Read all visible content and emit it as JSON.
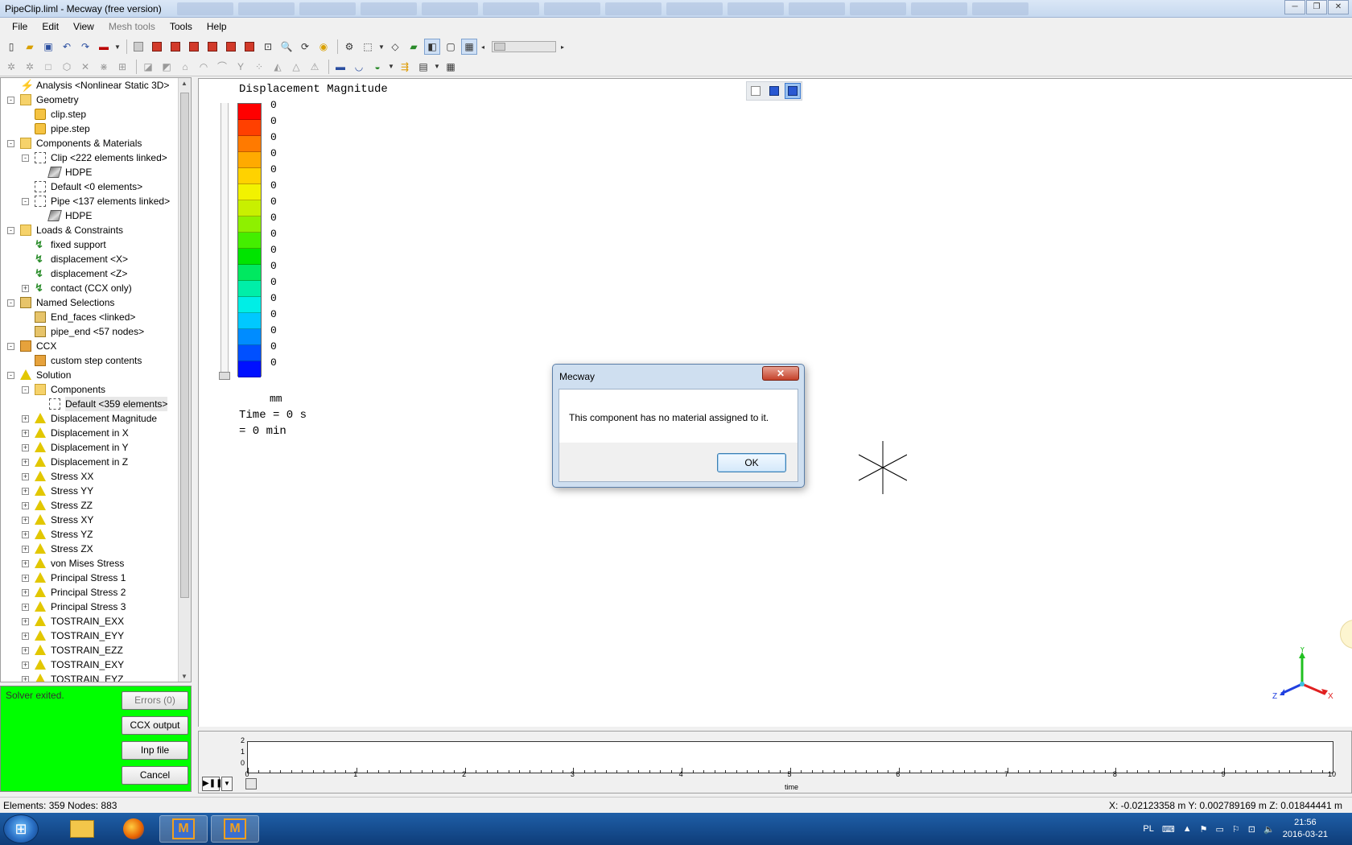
{
  "window": {
    "title": "PipeClip.liml - Mecway (free version)",
    "controls": [
      "─",
      "❐",
      "✕"
    ]
  },
  "menu": [
    "File",
    "Edit",
    "View",
    "Mesh tools",
    "Tools",
    "Help"
  ],
  "tree": {
    "items": [
      {
        "label": "Analysis <Nonlinear Static 3D>",
        "icon": "analysis-icon",
        "level": 1,
        "expander": ""
      },
      {
        "label": "Geometry",
        "icon": "folder-icon",
        "level": 1,
        "expander": "-"
      },
      {
        "label": "clip.step",
        "icon": "step-file-icon",
        "level": 2,
        "expander": ""
      },
      {
        "label": "pipe.step",
        "icon": "step-file-icon",
        "level": 2,
        "expander": ""
      },
      {
        "label": "Components & Materials",
        "icon": "components-folder-icon",
        "level": 1,
        "expander": "-"
      },
      {
        "label": "Clip <222 elements linked>",
        "icon": "component-icon",
        "level": 2,
        "expander": "-"
      },
      {
        "label": "HDPE",
        "icon": "material-icon",
        "level": 3,
        "expander": ""
      },
      {
        "label": "Default <0 elements>",
        "icon": "component-icon",
        "level": 2,
        "expander": ""
      },
      {
        "label": "Pipe <137 elements linked>",
        "icon": "component-icon",
        "level": 2,
        "expander": "-"
      },
      {
        "label": "HDPE",
        "icon": "material-icon",
        "level": 3,
        "expander": ""
      },
      {
        "label": "Loads & Constraints",
        "icon": "loads-folder-icon",
        "level": 1,
        "expander": "-"
      },
      {
        "label": "fixed support",
        "icon": "load-icon",
        "level": 2,
        "expander": ""
      },
      {
        "label": "displacement <X>",
        "icon": "load-icon",
        "level": 2,
        "expander": ""
      },
      {
        "label": "displacement <Z>",
        "icon": "load-icon",
        "level": 2,
        "expander": ""
      },
      {
        "label": "contact (CCX only)",
        "icon": "contact-icon",
        "level": 2,
        "expander": "+"
      },
      {
        "label": "Named Selections",
        "icon": "named-selection-folder-icon",
        "level": 1,
        "expander": "-"
      },
      {
        "label": "End_faces <linked>",
        "icon": "named-selection-icon",
        "level": 2,
        "expander": ""
      },
      {
        "label": "pipe_end <57 nodes>",
        "icon": "named-selection-icon",
        "level": 2,
        "expander": ""
      },
      {
        "label": "CCX",
        "icon": "ccx-folder-icon",
        "level": 1,
        "expander": "-"
      },
      {
        "label": "custom step contents",
        "icon": "ccx-icon",
        "level": 2,
        "expander": ""
      },
      {
        "label": "Solution",
        "icon": "solution-folder-icon",
        "level": 1,
        "expander": "-"
      },
      {
        "label": "Components",
        "icon": "components-folder-icon",
        "level": 2,
        "expander": "-"
      },
      {
        "label": "Default <359 elements>",
        "icon": "component-icon",
        "level": 3,
        "expander": "",
        "selected": true
      },
      {
        "label": "Displacement Magnitude",
        "icon": "solution-icon",
        "level": 2,
        "expander": "+"
      },
      {
        "label": "Displacement in X",
        "icon": "solution-icon",
        "level": 2,
        "expander": "+"
      },
      {
        "label": "Displacement in Y",
        "icon": "solution-icon",
        "level": 2,
        "expander": "+"
      },
      {
        "label": "Displacement in Z",
        "icon": "solution-icon",
        "level": 2,
        "expander": "+"
      },
      {
        "label": "Stress XX",
        "icon": "solution-icon",
        "level": 2,
        "expander": "+"
      },
      {
        "label": "Stress YY",
        "icon": "solution-icon",
        "level": 2,
        "expander": "+"
      },
      {
        "label": "Stress ZZ",
        "icon": "solution-icon",
        "level": 2,
        "expander": "+"
      },
      {
        "label": "Stress XY",
        "icon": "solution-icon",
        "level": 2,
        "expander": "+"
      },
      {
        "label": "Stress YZ",
        "icon": "solution-icon",
        "level": 2,
        "expander": "+"
      },
      {
        "label": "Stress ZX",
        "icon": "solution-icon",
        "level": 2,
        "expander": "+"
      },
      {
        "label": "von Mises Stress",
        "icon": "solution-icon",
        "level": 2,
        "expander": "+"
      },
      {
        "label": "Principal Stress 1",
        "icon": "solution-icon",
        "level": 2,
        "expander": "+"
      },
      {
        "label": "Principal Stress 2",
        "icon": "solution-icon",
        "level": 2,
        "expander": "+"
      },
      {
        "label": "Principal Stress 3",
        "icon": "solution-icon",
        "level": 2,
        "expander": "+"
      },
      {
        "label": "TOSTRAIN_EXX",
        "icon": "solution-icon",
        "level": 2,
        "expander": "+"
      },
      {
        "label": "TOSTRAIN_EYY",
        "icon": "solution-icon",
        "level": 2,
        "expander": "+"
      },
      {
        "label": "TOSTRAIN_EZZ",
        "icon": "solution-icon",
        "level": 2,
        "expander": "+"
      },
      {
        "label": "TOSTRAIN_EXY",
        "icon": "solution-icon",
        "level": 2,
        "expander": "+"
      },
      {
        "label": "TOSTRAIN_EYZ",
        "icon": "solution-icon",
        "level": 2,
        "expander": "+"
      }
    ]
  },
  "solver": {
    "status": "Solver exited.",
    "errors_label": "Errors (0)",
    "ccx_output_label": "CCX output",
    "inp_file_label": "Inp file",
    "cancel_label": "Cancel",
    "background_color": "#00ff00"
  },
  "legend": {
    "title": "Displacement Magnitude",
    "values": [
      "0",
      "0",
      "0",
      "0",
      "0",
      "0",
      "0",
      "0",
      "0",
      "0",
      "0",
      "0",
      "0",
      "0",
      "0",
      "0",
      "0"
    ],
    "colors": [
      "#ff0000",
      "#ff4000",
      "#ff7a00",
      "#ffaa00",
      "#ffd200",
      "#f2f200",
      "#c8f000",
      "#8ef000",
      "#44ee00",
      "#00e400",
      "#00e860",
      "#00eea8",
      "#00eee6",
      "#00c8ff",
      "#008cff",
      "#0050ff",
      "#0010ff"
    ],
    "unit": "mm",
    "time_line1": "Time = 0 s",
    "time_line2": "= 0 min"
  },
  "dialog": {
    "title": "Mecway",
    "message": "This component has no material assigned to it.",
    "ok_label": "OK",
    "close_label": "✕"
  },
  "triad": {
    "x_label": "X",
    "y_label": "Y",
    "z_label": "Z",
    "x_color": "#e02020",
    "y_color": "#20c020",
    "z_color": "#2040e0"
  },
  "timeline": {
    "y_labels": [
      "2",
      "1",
      "0"
    ],
    "x_labels": [
      "0",
      "1",
      "2",
      "3",
      "4",
      "5",
      "6",
      "7",
      "8",
      "9",
      "10"
    ],
    "axis_title": "time",
    "play_label": "▶❚❚",
    "drop_label": "▼"
  },
  "statusbar": {
    "elements": "Elements:  359    Nodes: 883",
    "coords": "X: -0.02123358 m Y: 0.002789169 m Z: 0.01844441 m"
  },
  "taskbar": {
    "start_label": "⊞",
    "language": "PL",
    "time": "21:56",
    "date": "2016-03-21"
  }
}
